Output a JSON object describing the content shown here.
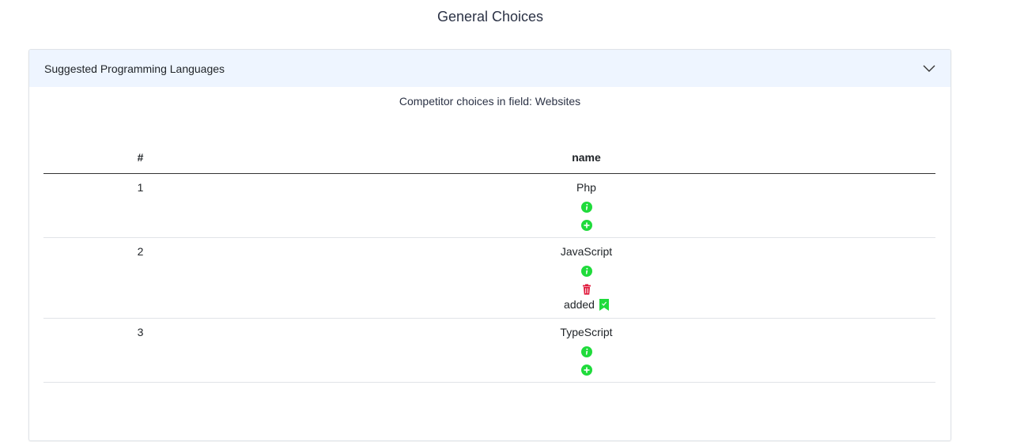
{
  "page": {
    "title": "General Choices"
  },
  "panel": {
    "title": "Suggested Programming Languages",
    "subtitle": "Competitor choices in field: Websites"
  },
  "table": {
    "columns": [
      "#",
      "name"
    ],
    "rows": [
      {
        "num": "1",
        "name": "Php",
        "actions": [
          "info-icon",
          "add-icon"
        ],
        "status": ""
      },
      {
        "num": "2",
        "name": "JavaScript",
        "actions": [
          "info-icon",
          "trash-icon"
        ],
        "status": "added"
      },
      {
        "num": "3",
        "name": "TypeScript",
        "actions": [
          "info-icon",
          "add-icon"
        ],
        "status": ""
      }
    ]
  },
  "colors": {
    "success": "#1fdb3b",
    "danger": "#e0173a",
    "header_bg": "#eef5ff"
  }
}
